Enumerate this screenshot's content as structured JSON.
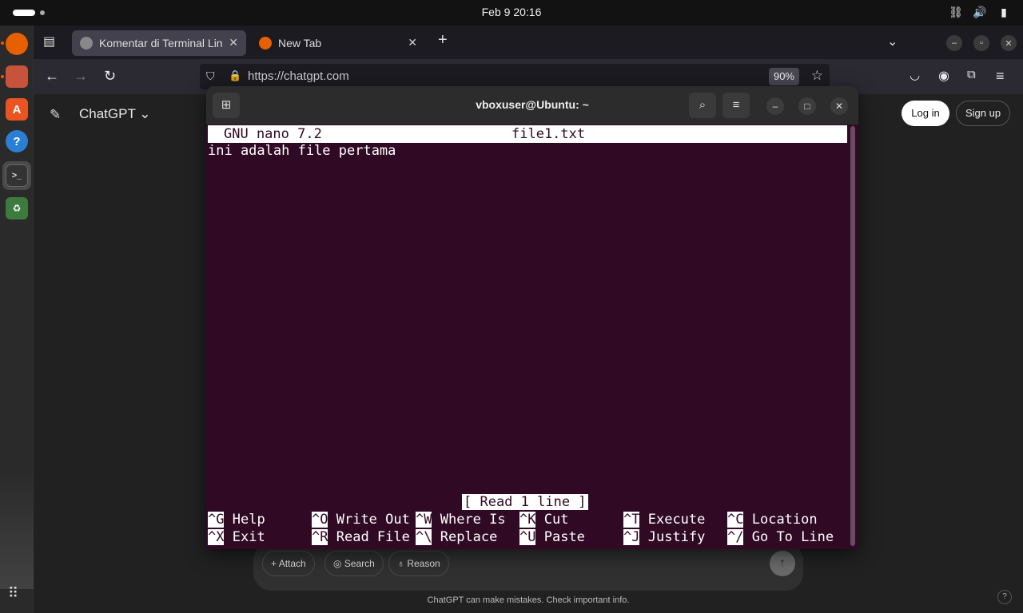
{
  "system": {
    "clock": "Feb 9  20:16"
  },
  "browser": {
    "tabs": [
      {
        "label": "Komentar di Terminal Lin",
        "active": true
      },
      {
        "label": "New Tab",
        "active": false
      }
    ],
    "url": "https://chatgpt.com",
    "zoom": "90%"
  },
  "page": {
    "brand": "ChatGPT",
    "login_label": "Log in",
    "signup_label": "Sign up",
    "composer": {
      "attach": "Attach",
      "search": "Search",
      "reason": "Reason"
    },
    "disclaimer": "ChatGPT can make mistakes. Check important info.",
    "help": "?"
  },
  "terminal": {
    "title": "vboxuser@Ubuntu: ~",
    "nano_version": "GNU nano 7.2",
    "file_name": "file1.txt",
    "content_line": "ini adalah file pertama",
    "status": "[ Read 1 line ]",
    "shortcuts_row1": [
      {
        "key": "^G",
        "label": "Help"
      },
      {
        "key": "^O",
        "label": "Write Out"
      },
      {
        "key": "^W",
        "label": "Where Is"
      },
      {
        "key": "^K",
        "label": "Cut"
      },
      {
        "key": "^T",
        "label": "Execute"
      },
      {
        "key": "^C",
        "label": "Location"
      }
    ],
    "shortcuts_row2": [
      {
        "key": "^X",
        "label": "Exit"
      },
      {
        "key": "^R",
        "label": "Read File"
      },
      {
        "key": "^\\",
        "label": "Replace"
      },
      {
        "key": "^U",
        "label": "Paste"
      },
      {
        "key": "^J",
        "label": "Justify"
      },
      {
        "key": "^/",
        "label": "Go To Line"
      }
    ]
  },
  "colors": {
    "terminal_bg": "#300a24",
    "accent": "#e95420"
  }
}
